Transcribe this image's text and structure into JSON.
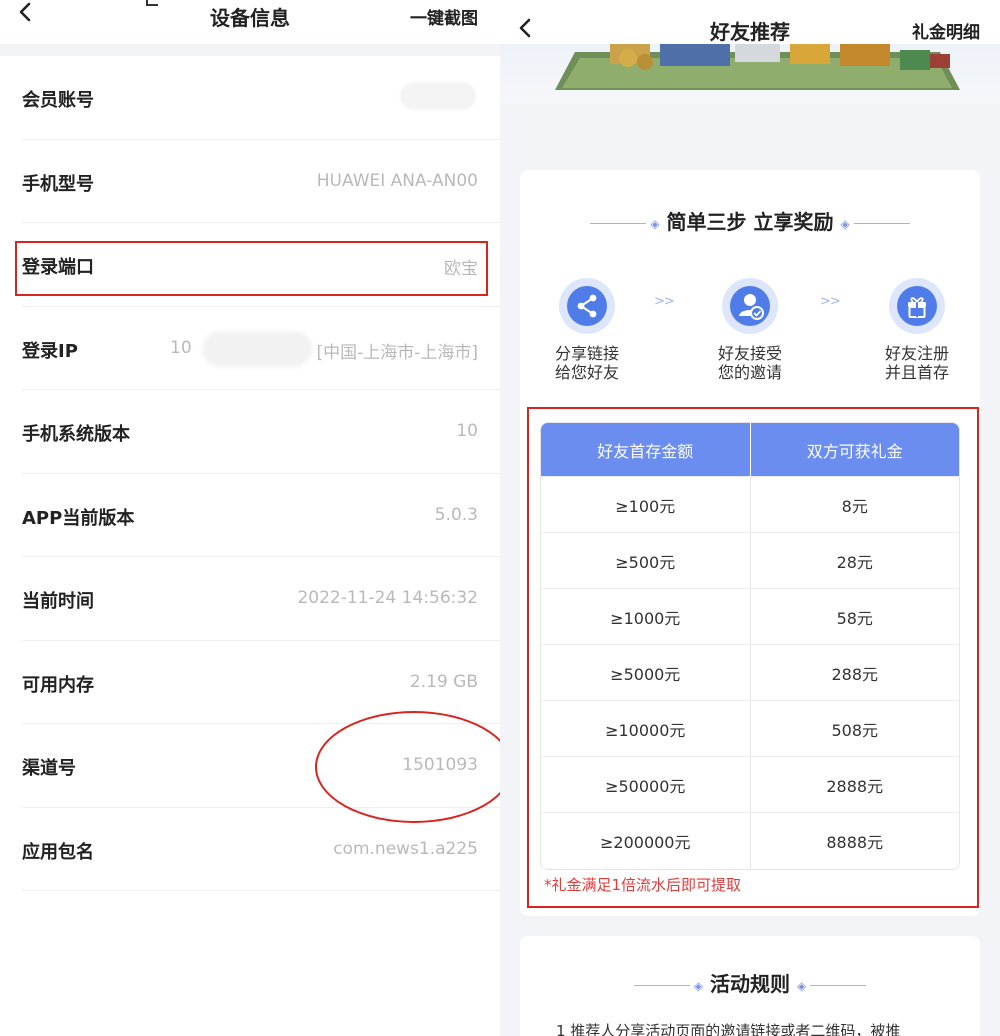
{
  "left": {
    "title": "设备信息",
    "action": "一键截图",
    "rows": [
      {
        "label": "会员账号",
        "value": ""
      },
      {
        "label": "手机型号",
        "value": "HUAWEI  ANA-AN00"
      },
      {
        "label": "登录端口",
        "value": "欧宝"
      },
      {
        "label": "登录IP",
        "value_prefix": "10",
        "value": "[中国-上海市-上海市]"
      },
      {
        "label": "手机系统版本",
        "value": "10"
      },
      {
        "label": "APP当前版本",
        "value": "5.0.3"
      },
      {
        "label": "当前时间",
        "value": "2022-11-24 14:56:32"
      },
      {
        "label": "可用内存",
        "value": "2.19 GB"
      },
      {
        "label": "渠道号",
        "value": "1501093"
      },
      {
        "label": "应用包名",
        "value": "com.news1.a225"
      }
    ]
  },
  "right": {
    "title": "好友推荐",
    "action": "礼金明细",
    "steps_title": "简单三步 立享奖励",
    "steps": [
      {
        "line1": "分享链接",
        "line2": "给您好友",
        "icon": "share-icon"
      },
      {
        "line1": "好友接受",
        "line2": "您的邀请",
        "icon": "user-check-icon"
      },
      {
        "line1": "好友注册",
        "line2": "并且首存",
        "icon": "gift-icon"
      }
    ],
    "arrows": ">>",
    "table": {
      "headers": [
        "好友首存金额",
        "双方可获礼金"
      ],
      "rows": [
        [
          "≥100元",
          "8元"
        ],
        [
          "≥500元",
          "28元"
        ],
        [
          "≥1000元",
          "58元"
        ],
        [
          "≥5000元",
          "288元"
        ],
        [
          "≥10000元",
          "508元"
        ],
        [
          "≥50000元",
          "2888元"
        ],
        [
          "≥200000元",
          "8888元"
        ]
      ]
    },
    "note": "*礼金满足1倍流水后即可提取",
    "rules_title": "活动规则",
    "rules_first_line": "1   推荐人分享活动页面的邀请链接或者二维码，被推"
  },
  "colors": {
    "accent": "#6b8df0",
    "annotation_red": "#d9231f",
    "note_red": "#e23b3b"
  }
}
